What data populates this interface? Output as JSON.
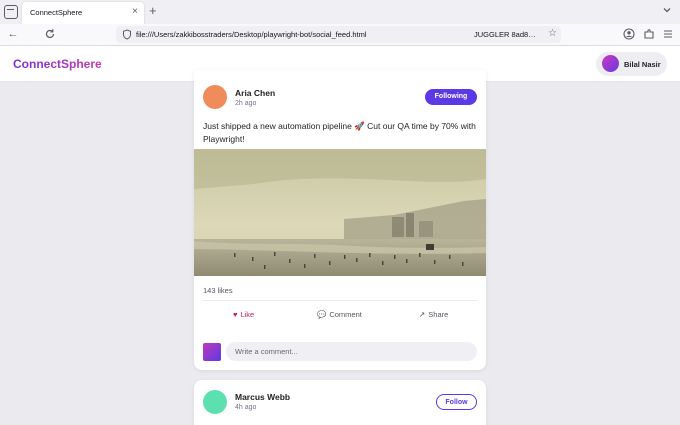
{
  "browser": {
    "tab_title": "ConnectSphere",
    "tab_close": "×",
    "new_tab": "+",
    "url": "file:///Users/zakkibosstraders/Desktop/playwright-bot/social_feed.html",
    "url_extra": "JUGGLER 8ad8…",
    "star": "☆"
  },
  "header": {
    "brand": "ConnectSphere",
    "user_name": "Bilal Nasir",
    "brand_gradient": [
      "#7a2fd6",
      "#c438b0"
    ]
  },
  "posts": [
    {
      "author": "Aria Chen",
      "time": "2h ago",
      "follow_label": "Following",
      "avatar_color": "#f08c5c",
      "text": "Just shipped a new automation pipeline 🚀 Cut our QA time by 70% with Playwright!",
      "likes": "143 likes",
      "actions": {
        "like": "Like",
        "comment": "Comment",
        "share": "Share"
      },
      "comment_placeholder": "Write a comment..."
    },
    {
      "author": "Marcus Webb",
      "time": "4h ago",
      "follow_label": "Follow",
      "avatar_color": "#5de0b0"
    }
  ],
  "colors": {
    "accent": "#5b3ae6",
    "like": "#c21f4f"
  },
  "icons": {
    "heart": "♥",
    "comment": "💬",
    "share": "↗"
  }
}
